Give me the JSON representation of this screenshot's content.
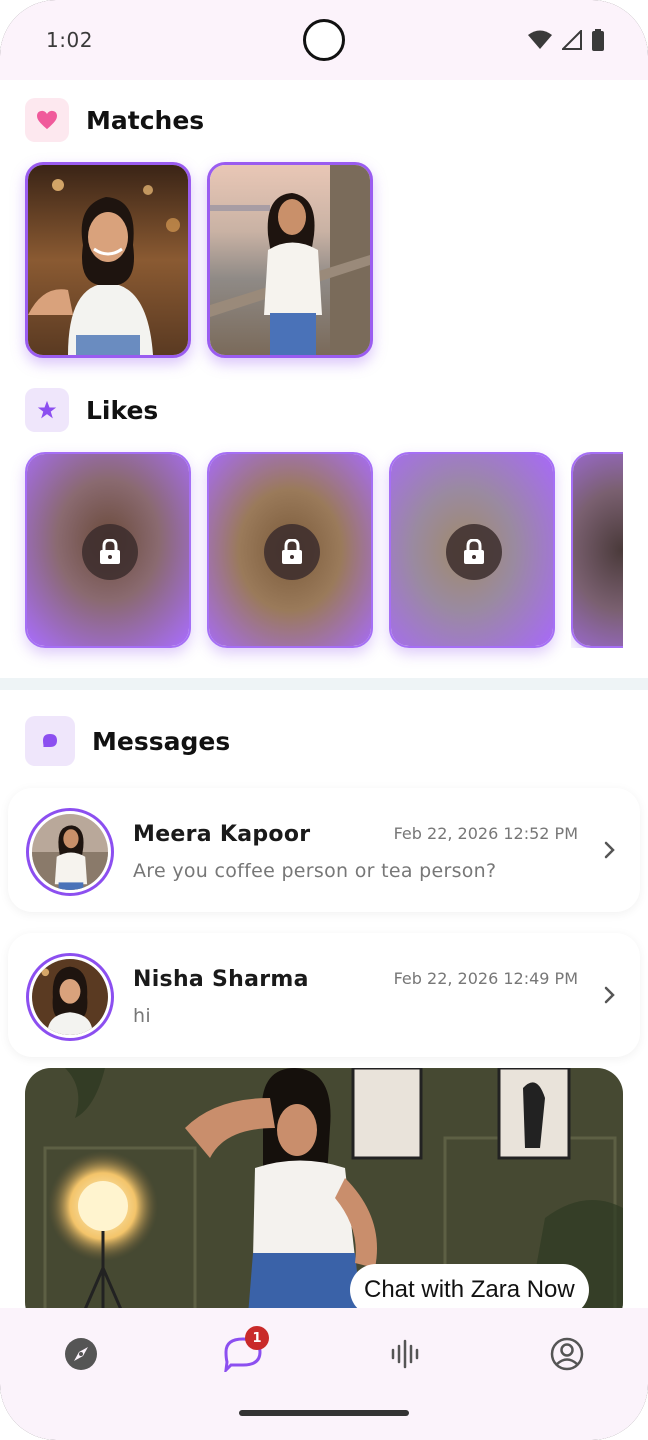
{
  "status_bar": {
    "time": "1:02"
  },
  "sections": {
    "matches": {
      "title": "Matches",
      "icon": "heart-icon",
      "accent": "#f05a9b"
    },
    "likes": {
      "title": "Likes",
      "icon": "star-icon",
      "accent": "#8c4ff0"
    },
    "messages": {
      "title": "Messages",
      "icon": "chat-bubble-icon",
      "accent": "#8c4ff0"
    }
  },
  "matches": [
    {
      "name": "match-1"
    },
    {
      "name": "match-2"
    }
  ],
  "likes": {
    "count_visible": 4,
    "locked": true
  },
  "messages": [
    {
      "name": "Meera Kapoor",
      "time": "Feb 22, 2026 12:52 PM",
      "preview": "Are you coffee person or tea person?"
    },
    {
      "name": "Nisha Sharma",
      "time": "Feb 22, 2026 12:49 PM",
      "preview": "hi"
    }
  ],
  "promo": {
    "cta": "Chat with Zara Now"
  },
  "bottom_nav": {
    "items": [
      "compass-icon",
      "chat-icon",
      "voice-wave-icon",
      "profile-icon"
    ],
    "active": "chat-icon",
    "chat_badge": "1"
  },
  "colors": {
    "primary": "#8c4ff0",
    "pink": "#f05a9b",
    "badge": "#c92a2a",
    "nav_bg": "#fbf3fb"
  }
}
